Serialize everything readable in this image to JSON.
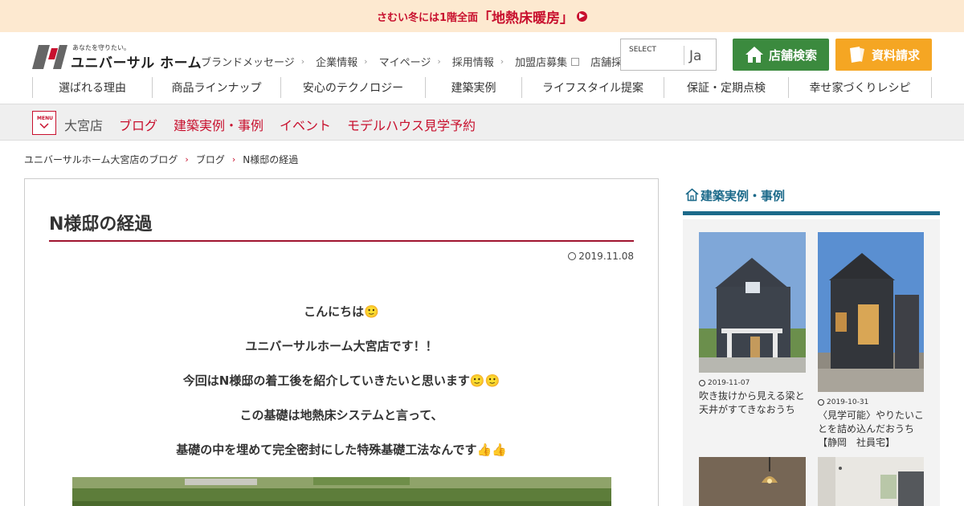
{
  "banner": {
    "small_text": "さむい冬には1階全面",
    "big_text": "「地熱床暖房」"
  },
  "logo": {
    "tagline": "あなたを守りたい。",
    "name": "ユニバーサル ホーム"
  },
  "topnav": {
    "items": [
      {
        "label": "ブランドメッセージ"
      },
      {
        "label": "企業情報"
      },
      {
        "label": "マイページ"
      },
      {
        "label": "採用情報"
      },
      {
        "label": "加盟店募集"
      },
      {
        "label": "店舗採用情報"
      }
    ]
  },
  "language_select": {
    "label": "SELECT",
    "value": "Ja"
  },
  "buttons": {
    "store_search": "店舗検索",
    "request_docs": "資料請求"
  },
  "mainnav": {
    "items": [
      {
        "label": "選ばれる理由"
      },
      {
        "label": "商品ラインナップ"
      },
      {
        "label": "安心のテクノロジー"
      },
      {
        "label": "建築実例"
      },
      {
        "label": "ライフスタイル提案"
      },
      {
        "label": "保証・定期点検"
      },
      {
        "label": "幸せ家づくりレシピ"
      }
    ]
  },
  "subbar": {
    "menu_label": "MENU",
    "store": "大宮店",
    "links": [
      "ブログ",
      "建築実例・事例",
      "イベント",
      "モデルハウス見学予約"
    ]
  },
  "breadcrumb": [
    "ユニバーサルホーム大宮店のブログ",
    "ブログ",
    "N様邸の経過"
  ],
  "article": {
    "title": "N様邸の経過",
    "date": "2019.11.08",
    "paragraphs": [
      "こんにちは🙂",
      "ユニバーサルホーム大宮店です！！",
      "今回はN様邸の着工後を紹介していきたいと思います🙂🙂",
      "この基礎は地熱床システムと言って、",
      "基礎の中を埋めて完全密封にした特殊基礎工法なんです👍👍"
    ]
  },
  "sidebar": {
    "title": "建築実例・事例",
    "cards": [
      {
        "date": "2019-11-07",
        "title": "吹き抜けから見える梁と天井がすてきなおうち"
      },
      {
        "date": "2019-10-31",
        "title": "〈見学可能〉やりたいことを詰め込んだおうち【静岡　社員宅】"
      },
      {
        "date": "",
        "title": ""
      },
      {
        "date": "",
        "title": ""
      }
    ]
  },
  "colors": {
    "brand_red": "#c8102e",
    "store_green": "#3b8a3e",
    "doc_orange": "#f5a623",
    "sidebar_blue": "#1c6a8a"
  }
}
